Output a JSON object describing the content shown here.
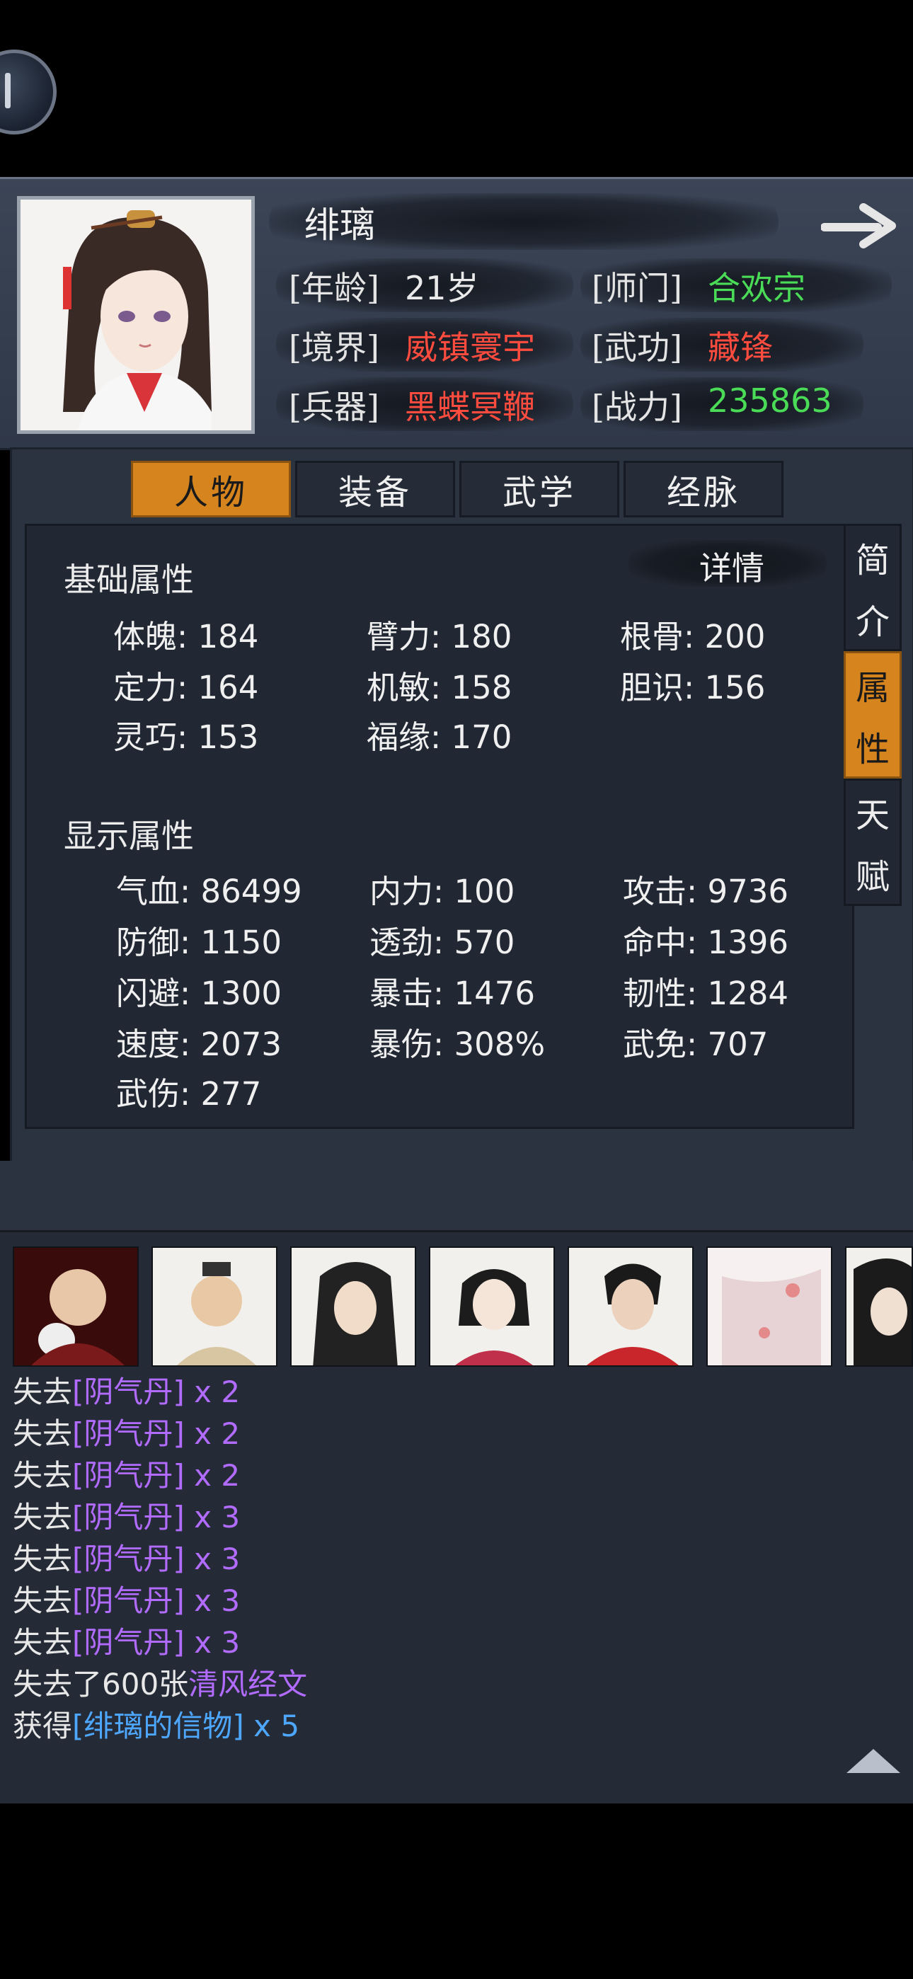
{
  "header": {
    "name": "绯璃",
    "rows": [
      {
        "l_label": "[年龄]",
        "l_value": "21岁",
        "r_label": "[师门]",
        "r_value": "合欢宗"
      },
      {
        "l_label": "[境界]",
        "l_value": "威镇寰宇",
        "r_label": "[武功]",
        "r_value": "藏锋"
      },
      {
        "l_label": "[兵器]",
        "l_value": "黑蝶冥鞭",
        "r_label": "[战力]",
        "r_value": "235863"
      }
    ]
  },
  "tabs": [
    "人物",
    "装备",
    "武学",
    "经脉"
  ],
  "side_tabs": [
    {
      "c1": "简",
      "c2": "介"
    },
    {
      "c1": "属",
      "c2": "性"
    },
    {
      "c1": "天",
      "c2": "赋"
    }
  ],
  "detail_label": "详情",
  "basic": {
    "title": "基础属性",
    "stats": [
      "体魄: 184",
      "臂力: 180",
      "根骨: 200",
      "定力: 164",
      "机敏: 158",
      "胆识: 156",
      "灵巧: 153",
      "福缘: 170"
    ]
  },
  "display": {
    "title": "显示属性",
    "stats": [
      "气血: 86499",
      "内力: 100",
      "攻击: 9736",
      "防御: 1150",
      "透劲: 570",
      "命中: 1396",
      "闪避: 1300",
      "暴击: 1476",
      "韧性: 1284",
      "速度: 2073",
      "暴伤: 308%",
      "武免: 707",
      "武伤: 277"
    ]
  },
  "log": [
    {
      "pre": "失去",
      "item": "[阴气丹]",
      "qty": " x 2",
      "color": "purple"
    },
    {
      "pre": "失去",
      "item": "[阴气丹]",
      "qty": " x 2",
      "color": "purple"
    },
    {
      "pre": "失去",
      "item": "[阴气丹]",
      "qty": " x 2",
      "color": "purple"
    },
    {
      "pre": "失去",
      "item": "[阴气丹]",
      "qty": " x 3",
      "color": "purple"
    },
    {
      "pre": "失去",
      "item": "[阴气丹]",
      "qty": " x 3",
      "color": "purple"
    },
    {
      "pre": "失去",
      "item": "[阴气丹]",
      "qty": " x 3",
      "color": "purple"
    },
    {
      "pre": "失去",
      "item": "[阴气丹]",
      "qty": " x 3",
      "color": "purple"
    },
    {
      "pre": "失去了600张",
      "item": "清风经文",
      "qty": "",
      "color": "purple"
    },
    {
      "pre": "获得",
      "item": "[绯璃的信物]",
      "qty": " x 5",
      "color": "blue"
    }
  ]
}
